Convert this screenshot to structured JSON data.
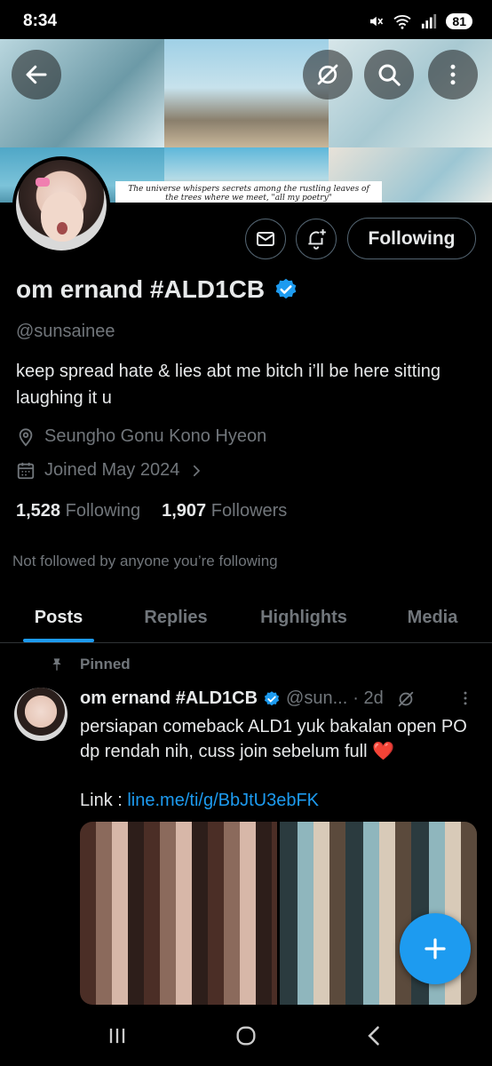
{
  "status_bar": {
    "time": "8:34",
    "battery": "81"
  },
  "banner": {
    "caption": "The universe whispers secrets among the rustling leaves of the trees where we meet, \"all my poetry\""
  },
  "profile": {
    "name": "om ernand #ALD1CB",
    "handle": "@sunsainee",
    "bio": "keep spread hate & lies abt me bitch i’ll be here sitting laughing it u",
    "location": "Seungho Gonu Kono Hyeon",
    "joined": "Joined May 2024",
    "following_count": "1,528",
    "following_label": "Following",
    "followers_count": "1,907",
    "followers_label": "Followers",
    "not_followed": "Not followed by anyone you’re following",
    "follow_button": "Following"
  },
  "tabs": [
    {
      "label": "Posts"
    },
    {
      "label": "Replies"
    },
    {
      "label": "Highlights"
    },
    {
      "label": "Media"
    }
  ],
  "post": {
    "pinned_label": "Pinned",
    "author_name": "om ernand #ALD1CB",
    "author_handle": "@sun...",
    "date": "· 2d",
    "text": "persiapan comeback ALD1 yuk bakalan open PO dp rendah nih, cuss join sebelum full ❤️",
    "link_prefix": "Link : ",
    "link": "line.me/ti/g/BbJtU3ebFK"
  },
  "colors": {
    "accent": "#1d9bf0",
    "muted": "#71767b",
    "text": "#e7e9ea",
    "background": "#000000"
  }
}
